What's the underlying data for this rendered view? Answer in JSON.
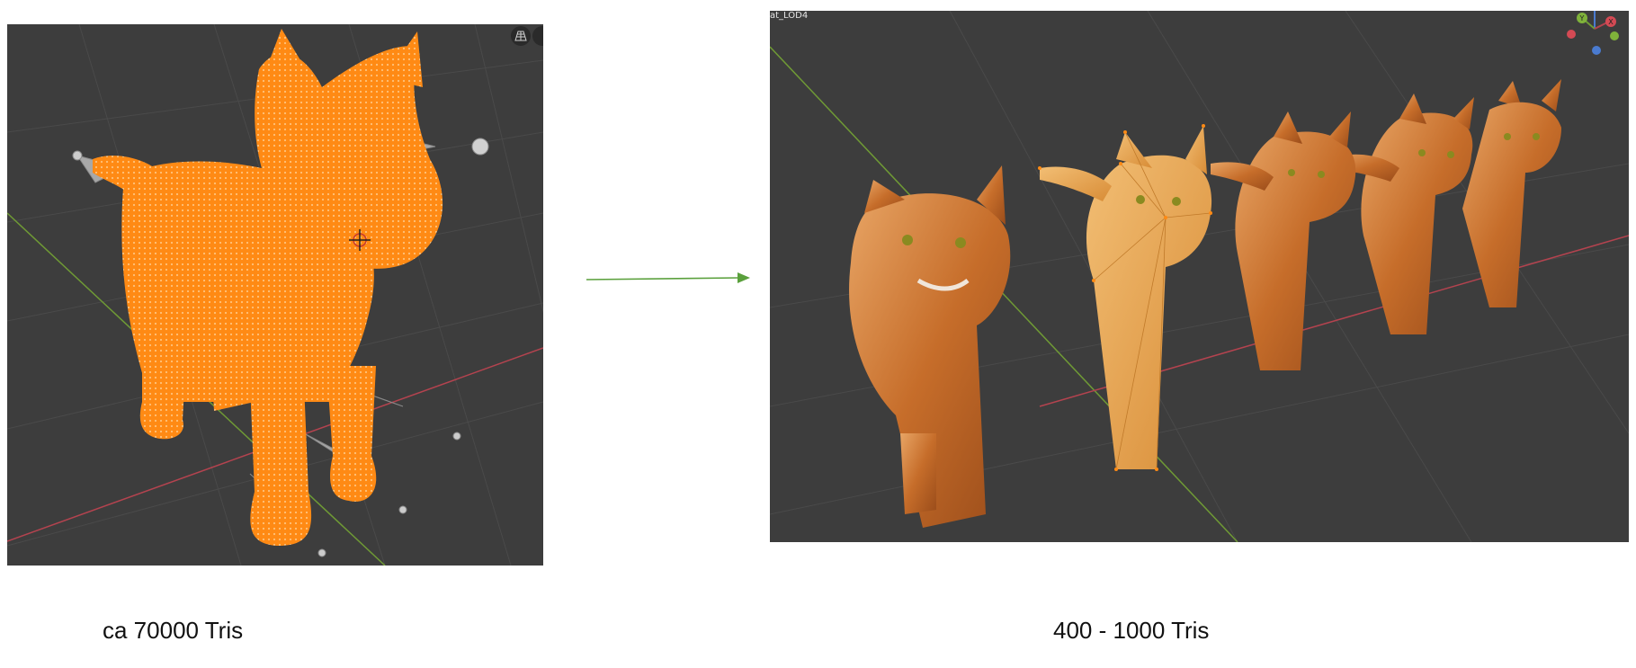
{
  "left_viewport": {
    "toolbar_icons": [
      "grid-icon",
      "view-icon"
    ]
  },
  "right_viewport": {
    "object_label": "at_LOD4",
    "gizmo_labels": {
      "y": "Y",
      "x": "X"
    }
  },
  "captions": {
    "left": "ca 70000 Tris",
    "right": "400 - 1000 Tris"
  },
  "colors": {
    "viewport_bg": "#3d3d3d",
    "grid_line": "#4a4a4a",
    "x_axis": "#b4434f",
    "y_axis": "#6f9a35",
    "selection_orange": "#ff8c16",
    "cat_fur": "#d9833c",
    "arrow": "#5aa03c"
  }
}
